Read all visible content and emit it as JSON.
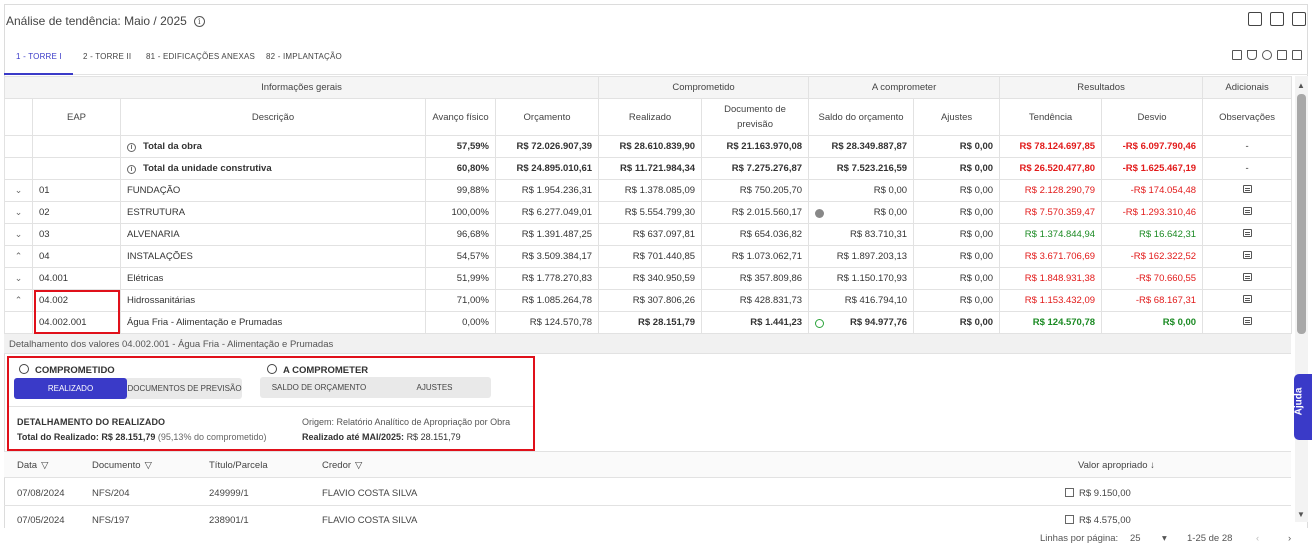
{
  "title": "Análise de tendência: Maio / 2025",
  "tabs": [
    "1 - TORRE I",
    "2 - TORRE II",
    "81 - EDIFICAÇÕES ANEXAS",
    "82 - IMPLANTAÇÃO"
  ],
  "group_headers": [
    "Informações gerais",
    "Comprometido",
    "A comprometer",
    "Resultados",
    "Adicionais"
  ],
  "columns": [
    "EAP",
    "Descrição",
    "Avanço físico",
    "Orçamento",
    "Realizado",
    "Documento de previsão",
    "Saldo do orçamento",
    "Ajustes",
    "Tendência",
    "Desvio",
    "Observações"
  ],
  "rows": [
    {
      "chev": "",
      "eap": "",
      "desc": "Total da obra",
      "avanco": "57,59%",
      "orc": "R$ 72.026.907,39",
      "real": "R$ 28.610.839,90",
      "doc": "R$ 21.163.970,08",
      "saldo": "R$ 28.349.887,87",
      "ajustes": "R$ 0,00",
      "tend": "R$ 78.124.697,85",
      "desvio": "-R$ 6.097.790,46",
      "obs": "-"
    },
    {
      "chev": "",
      "eap": "",
      "desc": "Total da unidade construtiva",
      "avanco": "60,80%",
      "orc": "R$ 24.895.010,61",
      "real": "R$ 11.721.984,34",
      "doc": "R$ 7.275.276,87",
      "saldo": "R$ 7.523.216,59",
      "ajustes": "R$ 0,00",
      "tend": "R$ 26.520.477,80",
      "desvio": "-R$ 1.625.467,19",
      "obs": "-"
    },
    {
      "chev": "⌄",
      "eap": "01",
      "desc": "FUNDAÇÃO",
      "avanco": "99,88%",
      "orc": "R$ 1.954.236,31",
      "real": "R$ 1.378.085,09",
      "doc": "R$ 750.205,70",
      "saldo": "R$ 0,00",
      "ajustes": "R$ 0,00",
      "tend": "R$ 2.128.290,79",
      "desvio": "-R$ 174.054,48",
      "obs": ""
    },
    {
      "chev": "⌄",
      "eap": "02",
      "desc": "ESTRUTURA",
      "avanco": "100,00%",
      "orc": "R$ 6.277.049,01",
      "real": "R$ 5.554.799,30",
      "doc": "R$ 2.015.560,17",
      "saldo": "R$ 0,00",
      "ajustes": "R$ 0,00",
      "tend": "R$ 7.570.359,47",
      "desvio": "-R$ 1.293.310,46",
      "obs": ""
    },
    {
      "chev": "⌄",
      "eap": "03",
      "desc": "ALVENARIA",
      "avanco": "96,68%",
      "orc": "R$ 1.391.487,25",
      "real": "R$ 637.097,81",
      "doc": "R$ 654.036,82",
      "saldo": "R$ 83.710,31",
      "ajustes": "R$ 0,00",
      "tend": "R$ 1.374.844,94",
      "desvio": "R$ 16.642,31",
      "obs": ""
    },
    {
      "chev": "⌃",
      "eap": "04",
      "desc": "INSTALAÇÕES",
      "avanco": "54,57%",
      "orc": "R$ 3.509.384,17",
      "real": "R$ 701.440,85",
      "doc": "R$ 1.073.062,71",
      "saldo": "R$ 1.897.203,13",
      "ajustes": "R$ 0,00",
      "tend": "R$ 3.671.706,69",
      "desvio": "-R$ 162.322,52",
      "obs": ""
    },
    {
      "chev": "⌄",
      "eap": "04.001",
      "desc": "Elétricas",
      "avanco": "51,99%",
      "orc": "R$ 1.778.270,83",
      "real": "R$ 340.950,59",
      "doc": "R$ 357.809,86",
      "saldo": "R$ 1.150.170,93",
      "ajustes": "R$ 0,00",
      "tend": "R$ 1.848.931,38",
      "desvio": "-R$ 70.660,55",
      "obs": ""
    },
    {
      "chev": "⌃",
      "eap": "04.002",
      "desc": "Hidrossanitárias",
      "avanco": "71,00%",
      "orc": "R$ 1.085.264,78",
      "real": "R$ 307.806,26",
      "doc": "R$ 428.831,73",
      "saldo": "R$ 416.794,10",
      "ajustes": "R$ 0,00",
      "tend": "R$ 1.153.432,09",
      "desvio": "-R$ 68.167,31",
      "obs": ""
    },
    {
      "chev": "",
      "eap": "04.002.001",
      "desc": "Água Fria - Alimentação e Prumadas",
      "avanco": "0,00%",
      "orc": "R$ 124.570,78",
      "real": "R$ 28.151,79",
      "doc": "R$ 1.441,23",
      "saldo": "R$ 94.977,76",
      "ajustes": "R$ 0,00",
      "tend": "R$ 124.570,78",
      "desvio": "R$ 0,00",
      "obs": ""
    }
  ],
  "detail": {
    "bar": "Detalhamento dos valores 04.002.001 - Água Fria - Alimentação e Prumadas",
    "comprometido": "COMPROMETIDO",
    "a_comprometer": "A COMPROMETER",
    "seg1": [
      "REALIZADO",
      "DOCUMENTOS DE PREVISÃO"
    ],
    "seg2": [
      "SALDO DE ORÇAMENTO",
      "AJUSTES"
    ],
    "title": "DETALHAMENTO DO REALIZADO",
    "total_label": "Total do Realizado:",
    "total_value": "R$ 28.151,79",
    "total_pct": "(95,13% do comprometido)",
    "origem": "Origem: Relatório Analítico de Apropriação por Obra",
    "ate_label": "Realizado até MAI/2025:",
    "ate_value": "R$ 28.151,79"
  },
  "sub_table": {
    "headers": [
      "Data",
      "Documento",
      "Título/Parcela",
      "Credor",
      "Valor apropriado ↓"
    ],
    "rows": [
      {
        "data": "07/08/2024",
        "doc": "NFS/204",
        "titulo": "249999/1",
        "credor": "FLAVIO COSTA SILVA",
        "valor": "R$ 9.150,00"
      },
      {
        "data": "07/05/2024",
        "doc": "NFS/197",
        "titulo": "238901/1",
        "credor": "FLAVIO COSTA SILVA",
        "valor": "R$ 4.575,00"
      }
    ]
  },
  "footer": {
    "rows_label": "Linhas por página:",
    "rows_value": "25",
    "range": "1-25 de 28"
  },
  "help": "Ajuda",
  "colors": {
    "accent": "#3a3ac8",
    "negative": "#e21a1a",
    "positive": "#1b8a23",
    "highlight": "#e0101a"
  }
}
